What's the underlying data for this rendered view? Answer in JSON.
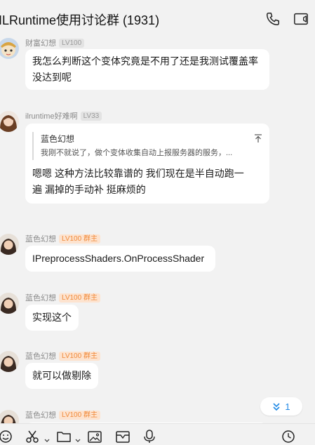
{
  "window": {
    "title": "ILRuntime使用讨论群 (1931)"
  },
  "messages": [
    {
      "sender": "财富幻想",
      "level": "LV100",
      "role": "",
      "lines": [
        "我怎么判断这个变体究竟是不用了还是我测试覆盖率",
        "没达到呢"
      ]
    },
    {
      "sender": "ilruntime好难啊",
      "level": "LV33",
      "role": "",
      "quote": {
        "author": "蓝色幻想",
        "text": "我刚不就说了，做个变体收集自动上报服务器的服务，..."
      },
      "lines": [
        "嗯嗯  这种方法比较靠谱的    我们现在是半自动跑一",
        "遍  漏掉的手动补   挺麻烦的"
      ]
    },
    {
      "sender": "蓝色幻想",
      "level": "LV100",
      "role": "群主",
      "lines": [
        "IPreprocessShaders.OnProcessShader"
      ]
    },
    {
      "sender": "蓝色幻想",
      "level": "LV100",
      "role": "群主",
      "lines": [
        "实现这个"
      ]
    },
    {
      "sender": "蓝色幻想",
      "level": "LV100",
      "role": "群主",
      "lines": [
        "就可以做剔除"
      ]
    },
    {
      "sender": "蓝色幻想",
      "level": "LV100",
      "role": "群主",
      "lines": []
    }
  ],
  "scroll_down": {
    "count": "1"
  },
  "toolbar_icons": [
    "emoji-icon",
    "scissors-icon",
    "folder-icon",
    "image-icon",
    "inbox-icon",
    "microphone-icon",
    "clock-icon"
  ],
  "colors": {
    "background": "#f2f2f2",
    "bubble": "#ffffff",
    "owner_badge_bg": "#fde3cf",
    "owner_badge_text": "#f08a3a",
    "accent": "#1e88e5"
  }
}
